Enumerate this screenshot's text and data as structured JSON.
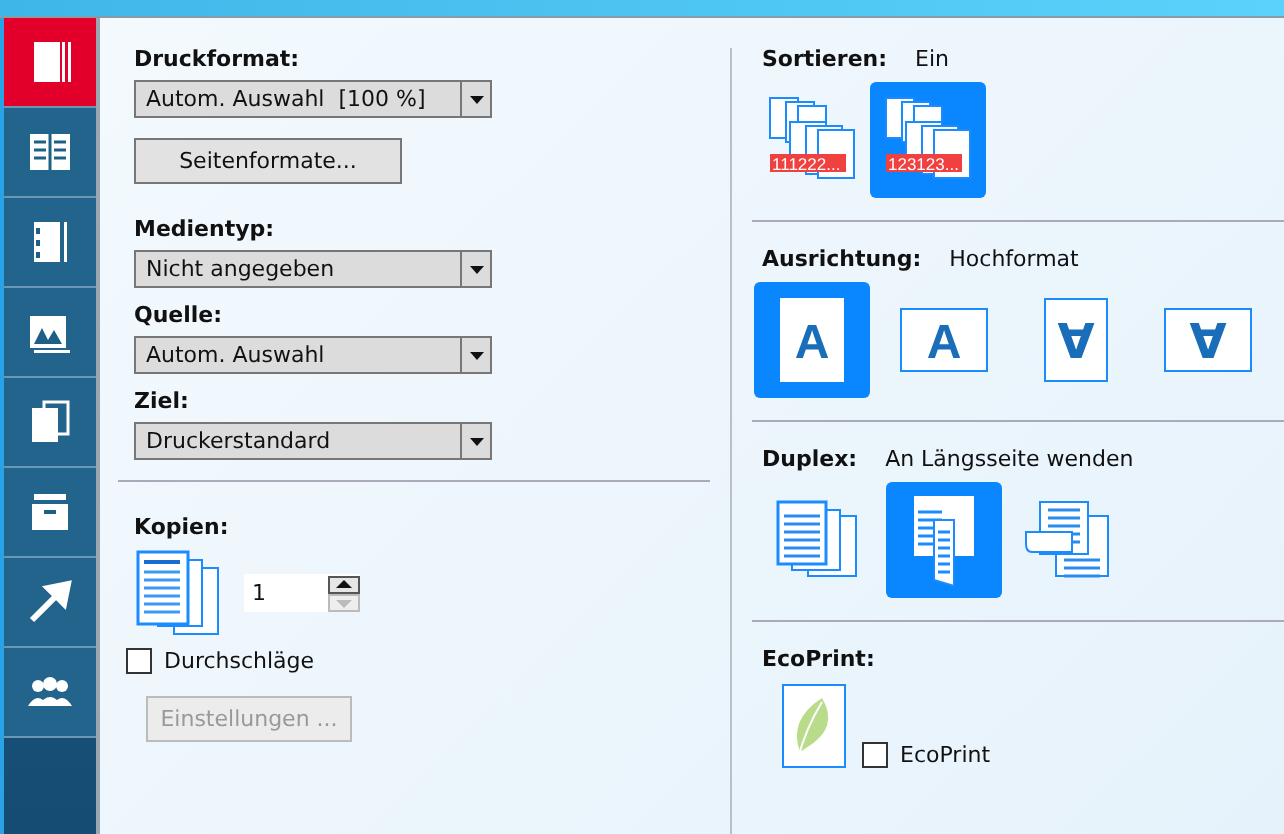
{
  "sidebar": {
    "items": [
      {
        "selected": true
      },
      {
        "selected": false
      },
      {
        "selected": false
      },
      {
        "selected": false
      },
      {
        "selected": false
      },
      {
        "selected": false
      },
      {
        "selected": false
      },
      {
        "selected": false
      }
    ]
  },
  "left": {
    "fields": [
      {
        "label": "Druckformat:",
        "value": "Autom. Auswahl  [100 %]",
        "button": "Seitenformate..."
      },
      {
        "label": "Medientyp:",
        "value": "Nicht angegeben"
      },
      {
        "label": "Quelle:",
        "value": "Autom. Auswahl"
      },
      {
        "label": "Ziel:",
        "value": "Druckerstandard"
      }
    ],
    "copies": {
      "label": "Kopien:",
      "value": "1"
    },
    "carbon": {
      "label": "Durchschläge",
      "checked": false
    },
    "settings_button": {
      "label": "Einstellungen ...",
      "disabled": true
    }
  },
  "right": {
    "sections": [
      {
        "kind": "collate",
        "label": "Sortieren:",
        "value": "Ein",
        "options": [
          {
            "caption": "111222...",
            "selected": false
          },
          {
            "caption": "123123...",
            "selected": true
          }
        ]
      },
      {
        "kind": "orientation",
        "label": "Ausrichtung:",
        "value": "Hochformat",
        "options": [
          {
            "glyph": "A",
            "selected": true
          },
          {
            "glyph": "A",
            "selected": false
          },
          {
            "glyph": "∀",
            "selected": false
          },
          {
            "glyph": "∀",
            "selected": false
          }
        ]
      },
      {
        "kind": "duplex",
        "label": "Duplex:",
        "value": "An Längsseite wenden",
        "options": [
          {
            "selected": false
          },
          {
            "selected": true
          },
          {
            "selected": false
          }
        ]
      },
      {
        "kind": "eco",
        "label": "EcoPrint:",
        "checkbox": {
          "label": "EcoPrint",
          "checked": false
        }
      }
    ]
  }
}
